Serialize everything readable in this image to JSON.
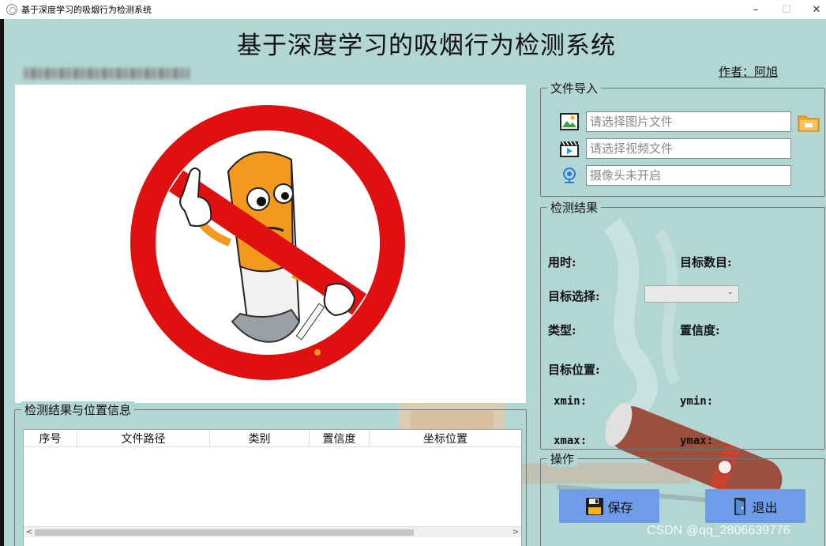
{
  "window": {
    "title": "基于深度学习的吸烟行为检测系统",
    "minimize": "–",
    "maximize": "☐",
    "close": "✕"
  },
  "app": {
    "title": "基于深度学习的吸烟行为检测系统",
    "author": "作者：阿旭"
  },
  "table_group": {
    "title": "检测结果与位置信息",
    "columns": [
      "序号",
      "文件路径",
      "类别",
      "置信度",
      "坐标位置"
    ]
  },
  "file_import": {
    "title": "文件导入",
    "image_placeholder": "请选择图片文件",
    "video_placeholder": "请选择视频文件",
    "camera_placeholder": "摄像头未开启"
  },
  "detection": {
    "title": "检测结果",
    "time_label": "用时:",
    "count_label": "目标数目:",
    "select_label": "目标选择:",
    "select_value": "",
    "type_label": "类型:",
    "conf_label": "置信度:",
    "position_label": "目标位置:",
    "xmin_label": "xmin:",
    "ymin_label": "ymin:",
    "xmax_label": "xmax:",
    "ymax_label": "ymax:"
  },
  "operations": {
    "title": "操作",
    "save_label": "保存",
    "exit_label": "退出"
  },
  "watermark": "CSDN @qq_2806639776",
  "colors": {
    "background": "#b2d6d2",
    "button": "#6f9ce8",
    "no_sign_red": "#e01010"
  }
}
